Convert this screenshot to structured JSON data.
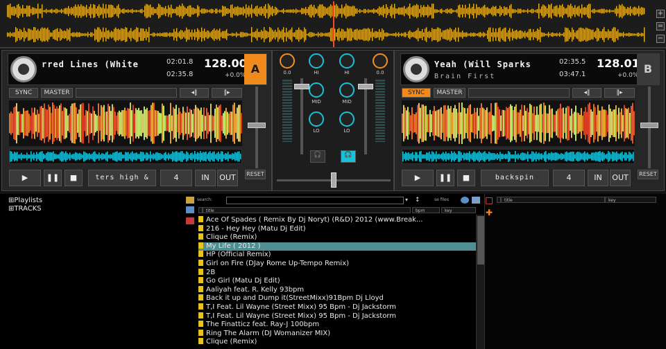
{
  "deckA": {
    "title": "rred Lines (White",
    "artist": "",
    "time1": "02:01.8",
    "time2": "02:35.8",
    "bpm": "128.00",
    "pitch": "+0.0%",
    "letter": "A",
    "sync": "SYNC",
    "master": "MASTER",
    "fx": "ters high &",
    "loop": "4",
    "in": "IN",
    "out": "OUT",
    "reset": "RESET"
  },
  "deckB": {
    "title": "Yeah (Will Sparks",
    "artist": "Brain First",
    "time1": "02:35.5",
    "time2": "03:47.1",
    "bpm": "128.01",
    "pitch": "+0.0%",
    "letter": "B",
    "sync": "SYNC",
    "master": "MASTER",
    "fx": "backspin",
    "loop": "4",
    "in": "IN",
    "out": "OUT",
    "reset": "RESET"
  },
  "mixer": {
    "gainA": "0.0",
    "gainB": "0.0",
    "hi": "HI",
    "mid": "MID",
    "lo": "LO"
  },
  "tree": {
    "items": [
      "Playlists",
      "TRACKS"
    ]
  },
  "search": {
    "label": "search:",
    "files": "se files"
  },
  "columns": {
    "title": "title",
    "bpm": "bpm",
    "key": "key",
    "title2": "title",
    "key2": "key"
  },
  "tracks": [
    "Ace Of Spades ( Remix By Dj Noryt) (R&D) 2012 (www.Break...",
    "216 - Hey Hey (Matu Dj Edit)",
    "Clique (Remix)",
    "My Life ( 2012 )",
    "HP (Official Remix)",
    "Girl on Fire (DJay Rome Up-Tempo Remix)",
    "2B",
    "Go Girl (Matu Dj Edit)",
    "Aaliyah feat. R. Kelly 93bpm",
    "Back it up and Dump it(StreetMixx)91Bpm Dj Lloyd",
    "T,I Feat. Lil Wayne (Street Mixx) 95 Bpm - Dj Jackstorm",
    "T,I Feat. Lil Wayne (Street Mixx) 95 Bpm - Dj Jackstorm",
    "The Finatticz feat. Ray-J 100bpm",
    "Ring The Alarm (DJ Womanizer MIX)",
    "Clique (Remix)"
  ],
  "selectedIndex": 3,
  "colors": {
    "accent": "#f08a1c",
    "cyan": "#19c0d8",
    "selected": "#4d8f93",
    "wave": "#e8b423"
  }
}
